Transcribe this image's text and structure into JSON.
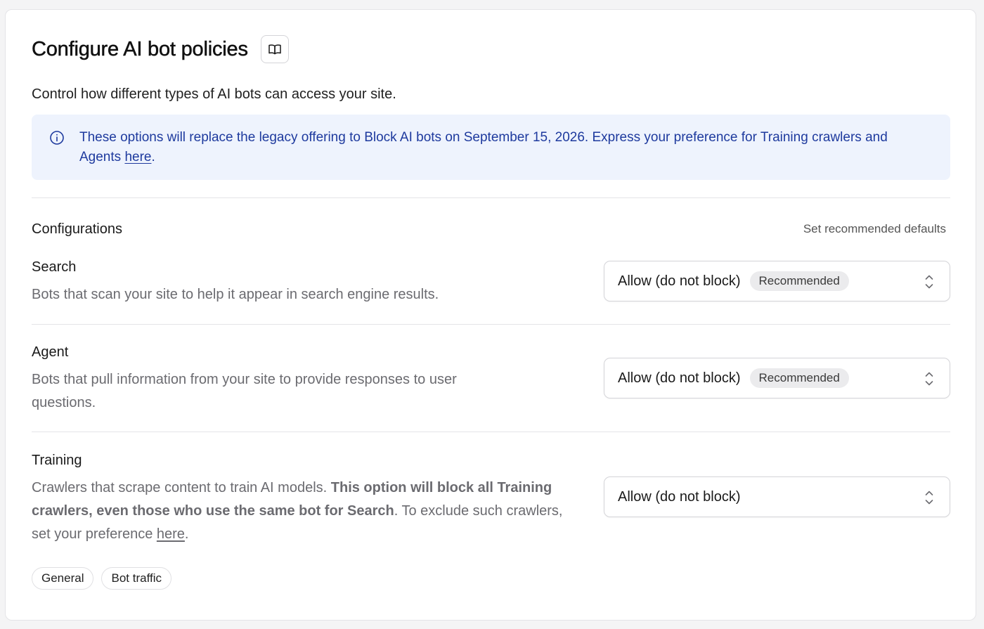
{
  "header": {
    "title": "Configure AI bot policies",
    "docs_icon": "book-icon",
    "subtitle": "Control how different types of AI bots can access your site."
  },
  "notice": {
    "icon": "info-icon",
    "text": "These options will replace the legacy offering to Block AI bots on September 15, 2026. Express your preference for Training crawlers and Agents ",
    "link_text": "here",
    "suffix": "."
  },
  "configurations": {
    "title": "Configurations",
    "defaults_link": "Set recommended defaults"
  },
  "rows": [
    {
      "title": "Search",
      "description": "Bots that scan your site to help it appear in search engine results.",
      "selected": "Allow (do not block)",
      "badge": "Recommended"
    },
    {
      "title": "Agent",
      "description": "Bots that pull information from your site to provide responses to user questions.",
      "selected": "Allow (do not block)",
      "badge": "Recommended"
    },
    {
      "title": "Training",
      "description_prefix": "Crawlers that scrape content to train AI models. ",
      "description_bold": "This option will block all Training crawlers, even those who use the same bot for Search",
      "description_mid": ". To exclude such crawlers, set your preference ",
      "description_link": "here",
      "description_suffix": ".",
      "selected": "Allow (do not block)"
    }
  ],
  "tags": [
    "General",
    "Bot traffic"
  ],
  "colors": {
    "notice_bg": "#eef3fd",
    "notice_text": "#1e3a9e",
    "badge_bg": "#ebebed"
  }
}
